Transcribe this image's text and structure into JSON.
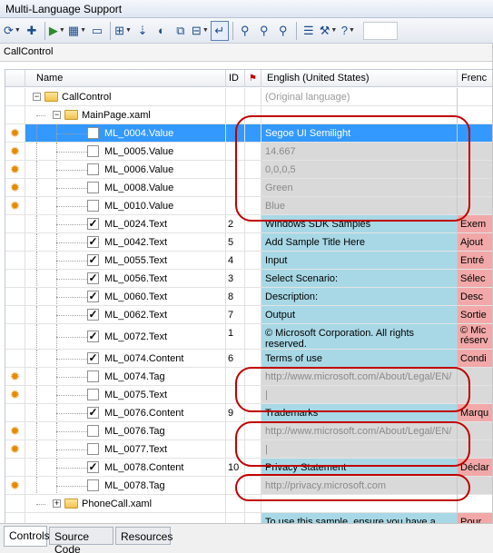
{
  "window": {
    "title": "Multi-Language Support"
  },
  "path": "CallControl",
  "toolbar": [
    {
      "name": "refresh-icon",
      "glyph": "⟳",
      "dd": true
    },
    {
      "name": "add-icon",
      "glyph": "✚"
    },
    {
      "name": "sep"
    },
    {
      "name": "run-icon",
      "glyph": "▶",
      "dd": true,
      "green": true
    },
    {
      "name": "grid-icon",
      "glyph": "▦",
      "dd": true
    },
    {
      "name": "window-icon",
      "glyph": "▭"
    },
    {
      "name": "sep"
    },
    {
      "name": "outline-icon",
      "glyph": "⊞",
      "dd": true
    },
    {
      "name": "sort-icon",
      "glyph": "⇣"
    },
    {
      "name": "contrast-icon",
      "glyph": "◐"
    },
    {
      "name": "frame-icon",
      "glyph": "⧉"
    },
    {
      "name": "columns-icon",
      "glyph": "⊟",
      "dd": true
    },
    {
      "name": "wrap-icon",
      "glyph": "↵",
      "active": true
    },
    {
      "name": "sep"
    },
    {
      "name": "find-icon",
      "glyph": "⚲"
    },
    {
      "name": "find-next-icon",
      "glyph": "⚲"
    },
    {
      "name": "find-prev-icon",
      "glyph": "⚲"
    },
    {
      "name": "sep"
    },
    {
      "name": "properties-icon",
      "glyph": "☰"
    },
    {
      "name": "tools-icon",
      "glyph": "⚒",
      "dd": true
    },
    {
      "name": "help-icon",
      "glyph": "?",
      "dd": true
    }
  ],
  "columns": {
    "name": "Name",
    "id": "ID",
    "english": "English (United States)",
    "french": "Frenc"
  },
  "rows": [
    {
      "label": "CallControl",
      "kind": "folder",
      "level": 0,
      "expander": "−",
      "en": "(Original language)",
      "fr": "",
      "style": "plain"
    },
    {
      "label": "MainPage.xaml",
      "kind": "folder",
      "level": 1,
      "expander": "−",
      "en": "",
      "fr": "",
      "style": "plain"
    },
    {
      "label": "ML_0004.Value",
      "kind": "item",
      "checked": false,
      "sun": true,
      "id": "",
      "en": "Segoe UI Semilight",
      "fr": "",
      "style": "sel"
    },
    {
      "label": "ML_0005.Value",
      "kind": "item",
      "checked": false,
      "sun": true,
      "id": "",
      "en": "14.667",
      "fr": "",
      "style": "gray"
    },
    {
      "label": "ML_0006.Value",
      "kind": "item",
      "checked": false,
      "sun": true,
      "id": "",
      "en": "0,0,0,5",
      "fr": "",
      "style": "gray"
    },
    {
      "label": "ML_0008.Value",
      "kind": "item",
      "checked": false,
      "sun": true,
      "id": "",
      "en": "Green",
      "fr": "",
      "style": "gray"
    },
    {
      "label": "ML_0010.Value",
      "kind": "item",
      "checked": false,
      "sun": true,
      "id": "",
      "en": "Blue",
      "fr": "",
      "style": "gray"
    },
    {
      "label": "ML_0024.Text",
      "kind": "item",
      "checked": true,
      "sun": false,
      "id": "2",
      "en": "Windows SDK Samples",
      "fr": "Exem",
      "style": "trans"
    },
    {
      "label": "ML_0042.Text",
      "kind": "item",
      "checked": true,
      "sun": false,
      "id": "5",
      "en": "Add Sample Title Here",
      "fr": "Ajout",
      "style": "trans"
    },
    {
      "label": "ML_0055.Text",
      "kind": "item",
      "checked": true,
      "sun": false,
      "id": "4",
      "en": "Input",
      "fr": "Entré",
      "style": "trans"
    },
    {
      "label": "ML_0056.Text",
      "kind": "item",
      "checked": true,
      "sun": false,
      "id": "3",
      "en": "Select Scenario:",
      "fr": "Sélec",
      "style": "trans"
    },
    {
      "label": "ML_0060.Text",
      "kind": "item",
      "checked": true,
      "sun": false,
      "id": "8",
      "en": "Description:",
      "fr": "Desc",
      "style": "trans"
    },
    {
      "label": "ML_0062.Text",
      "kind": "item",
      "checked": true,
      "sun": false,
      "id": "7",
      "en": "Output",
      "fr": "Sortie",
      "style": "trans"
    },
    {
      "label": "ML_0072.Text",
      "kind": "item",
      "checked": true,
      "sun": false,
      "id": "1",
      "en": "© Microsoft Corporation. All rights reserved.",
      "fr": "© Mic réserv",
      "style": "trans",
      "tall": true
    },
    {
      "label": "ML_0074.Content",
      "kind": "item",
      "checked": true,
      "sun": false,
      "id": "6",
      "en": "Terms of use",
      "fr": "Condi",
      "style": "trans"
    },
    {
      "label": "ML_0074.Tag",
      "kind": "item",
      "checked": false,
      "sun": true,
      "id": "",
      "en": "http://www.microsoft.com/About/Legal/EN/",
      "fr": "",
      "style": "gray"
    },
    {
      "label": "ML_0075.Text",
      "kind": "item",
      "checked": false,
      "sun": true,
      "id": "",
      "en": "|",
      "fr": "",
      "style": "gray"
    },
    {
      "label": "ML_0076.Content",
      "kind": "item",
      "checked": true,
      "sun": false,
      "id": "9",
      "en": "Trademarks",
      "fr": "Marqu",
      "style": "trans"
    },
    {
      "label": "ML_0076.Tag",
      "kind": "item",
      "checked": false,
      "sun": true,
      "id": "",
      "en": "http://www.microsoft.com/About/Legal/EN/",
      "fr": "",
      "style": "gray"
    },
    {
      "label": "ML_0077.Text",
      "kind": "item",
      "checked": false,
      "sun": true,
      "id": "",
      "en": "|",
      "fr": "",
      "style": "gray"
    },
    {
      "label": "ML_0078.Content",
      "kind": "item",
      "checked": true,
      "sun": false,
      "id": "10",
      "en": "Privacy Statement",
      "fr": "Déclar",
      "style": "trans"
    },
    {
      "label": "ML_0078.Tag",
      "kind": "item",
      "checked": false,
      "sun": true,
      "id": "",
      "en": "http://privacy.microsoft.com",
      "fr": "",
      "style": "gray"
    },
    {
      "label": "PhoneCall.xaml",
      "kind": "folder",
      "level": 1,
      "expander": "+",
      "en": "",
      "fr": "",
      "style": "plain"
    },
    {
      "label": "",
      "kind": "blank",
      "en": "To use this sample, ensure you have a",
      "fr": "Pour",
      "style": "trans"
    }
  ],
  "tabs": [
    {
      "label": "Controls",
      "active": true
    },
    {
      "label": "Source Code",
      "active": false
    },
    {
      "label": "Resources",
      "active": false
    }
  ],
  "colors": {
    "translated": "#a8d8e6",
    "french": "#f2a8a8",
    "untranslatable": "#d9d9d9",
    "selected": "#3399ff",
    "annotation": "#c00000"
  }
}
